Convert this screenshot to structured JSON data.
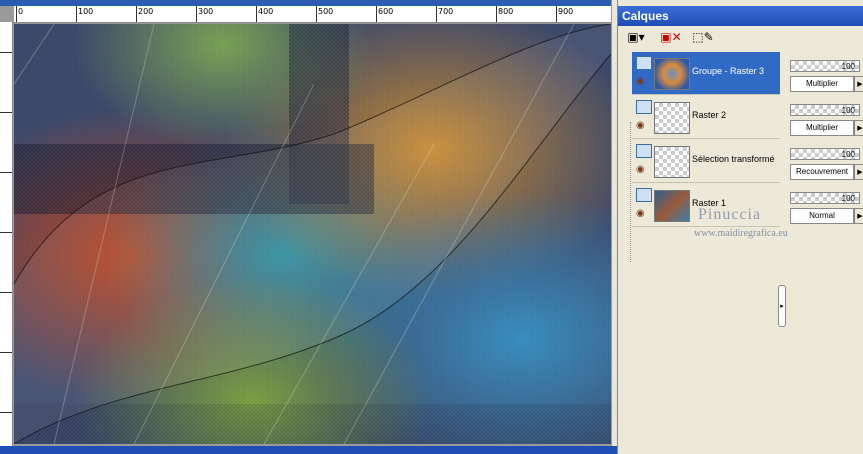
{
  "ruler": {
    "labels": [
      "0",
      "100",
      "200",
      "300",
      "400",
      "500",
      "600",
      "700",
      "800",
      "900"
    ]
  },
  "panel": {
    "title": "Calques",
    "layers": [
      {
        "name": "Groupe - Raster 3",
        "opacity": "100",
        "blend": "Multiplier",
        "selected": true
      },
      {
        "name": "Raster 2",
        "opacity": "100",
        "blend": "Multiplier",
        "selected": false
      },
      {
        "name": "Sélection transformé",
        "opacity": "100",
        "blend": "Recouvrement",
        "selected": false
      },
      {
        "name": "Raster 1",
        "opacity": "100",
        "blend": "Normal",
        "selected": false
      }
    ]
  },
  "watermark": {
    "line1": "Pinuccia",
    "line2": "www.maidiregrafica.eu"
  },
  "colors": {
    "accent": "#316ac5",
    "titlebar": "#1f4fb5"
  }
}
